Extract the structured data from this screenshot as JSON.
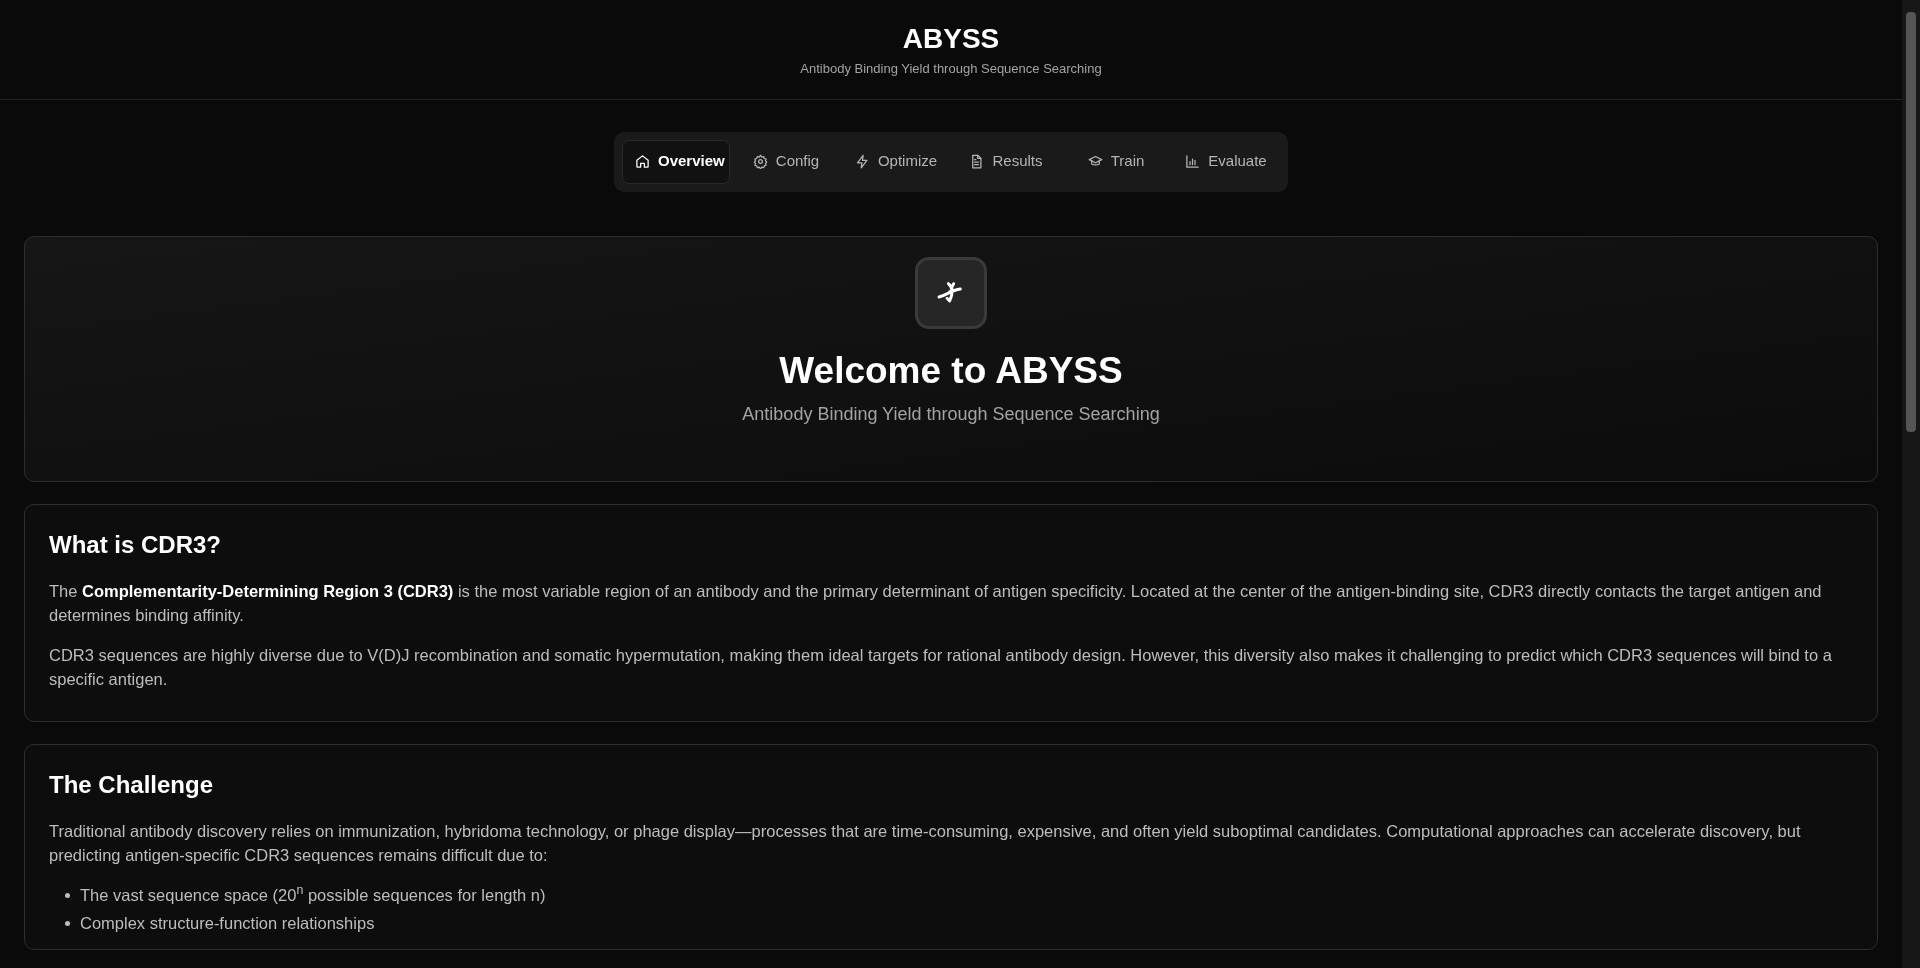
{
  "header": {
    "title": "ABYSS",
    "subtitle": "Antibody Binding Yield through Sequence Searching"
  },
  "tabs": [
    {
      "label": "Overview",
      "selected": true
    },
    {
      "label": "Config",
      "selected": false
    },
    {
      "label": "Optimize",
      "selected": false
    },
    {
      "label": "Results",
      "selected": false
    },
    {
      "label": "Train",
      "selected": false
    },
    {
      "label": "Evaluate",
      "selected": false
    }
  ],
  "hero": {
    "title": "Welcome to ABYSS",
    "subtitle": "Antibody Binding Yield through Sequence Searching"
  },
  "sections": [
    {
      "heading": "What is CDR3?",
      "paragraphs": [
        "The **Complementarity-Determining Region 3 (CDR3)** is the most variable region of an antibody and the primary determinant of antigen specificity. Located at the center of the antigen-binding site, CDR3 directly contacts the target antigen and determines binding affinity.",
        "CDR3 sequences are highly diverse due to V(D)J recombination and somatic hypermutation, making them ideal targets for rational antibody design. However, this diversity also makes it challenging to predict which CDR3 sequences will bind to a specific antigen."
      ]
    },
    {
      "heading": "The Challenge",
      "paragraphs": [
        "Traditional antibody discovery relies on immunization, hybridoma technology, or phage display—processes that are time-consuming, expensive, and often yield suboptimal candidates. Computational approaches can accelerate discovery, but predicting antigen-specific CDR3 sequences remains difficult due to:"
      ],
      "bullets": [
        "The vast sequence space (20$^{n}$ possible sequences for length n)",
        "Complex structure-function relationships"
      ]
    }
  ]
}
